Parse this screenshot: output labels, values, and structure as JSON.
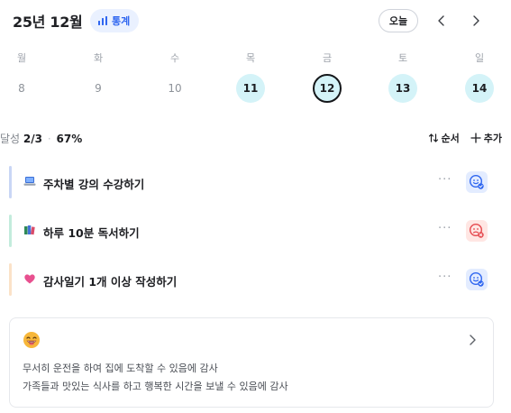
{
  "header": {
    "month": "25년 12월",
    "stats_label": "통계",
    "today_label": "오늘"
  },
  "week": [
    {
      "name": "월",
      "date": "8",
      "state": "none"
    },
    {
      "name": "화",
      "date": "9",
      "state": "none"
    },
    {
      "name": "수",
      "date": "10",
      "state": "none"
    },
    {
      "name": "목",
      "date": "11",
      "state": "done"
    },
    {
      "name": "금",
      "date": "12",
      "state": "selected"
    },
    {
      "name": "토",
      "date": "13",
      "state": "done"
    },
    {
      "name": "일",
      "date": "14",
      "state": "done"
    }
  ],
  "summary": {
    "label": "달성",
    "count": "2/3",
    "percent": "67%",
    "sort_label": "순서",
    "add_label": "추가"
  },
  "tasks": [
    {
      "title": "주차별 강의 수강하기",
      "emoji": "laptop-icon",
      "bar_color": "#c9d6f5",
      "status": "good",
      "more": "···"
    },
    {
      "title": "하루 10분 독서하기",
      "emoji": "books-icon",
      "bar_color": "#c3ecdc",
      "status": "bad",
      "more": "···"
    },
    {
      "title": "감사일기 1개 이상 작성하기",
      "emoji": "heart-icon",
      "bar_color": "#fbe2c8",
      "status": "good",
      "more": "···"
    }
  ],
  "gratitude": {
    "emoji": "grinning-face-icon",
    "lines": [
      "무서히 운전을 하여 집에 도착할 수 있음에 감사",
      "가족들과 맛있는 식사를 하고 행복한 시간을 보낼 수 있음에 감사"
    ]
  },
  "colors": {
    "accent_blue": "#2f66f0",
    "day_done_bg": "#d4f3f8",
    "status_good_bg": "#e3ecff",
    "status_bad_bg": "#ffe6e3"
  }
}
